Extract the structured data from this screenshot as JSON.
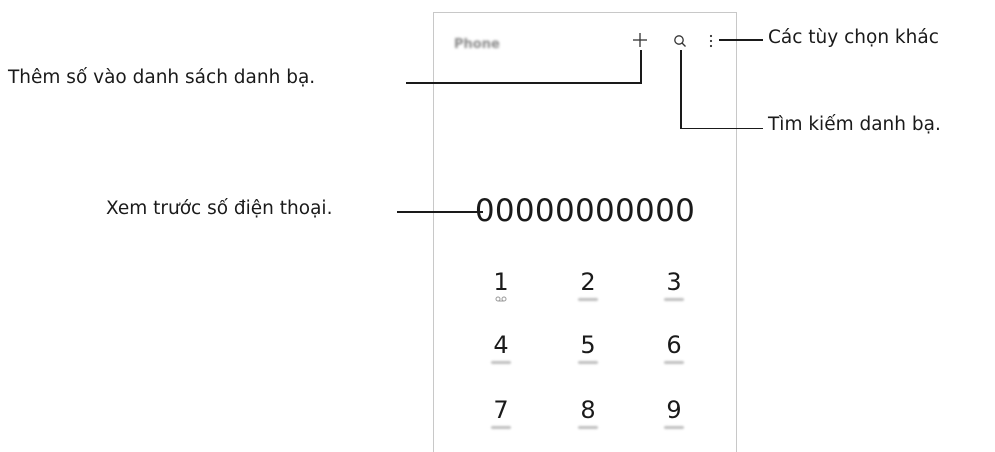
{
  "app": {
    "title": "Phone"
  },
  "number_preview": "00000000000",
  "keypad": [
    {
      "digit": "1",
      "sub": "voicemail-icon"
    },
    {
      "digit": "2",
      "sub": ""
    },
    {
      "digit": "3",
      "sub": ""
    },
    {
      "digit": "4",
      "sub": ""
    },
    {
      "digit": "5",
      "sub": ""
    },
    {
      "digit": "6",
      "sub": ""
    },
    {
      "digit": "7",
      "sub": ""
    },
    {
      "digit": "8",
      "sub": ""
    },
    {
      "digit": "9",
      "sub": ""
    }
  ],
  "callouts": {
    "more_options": "Các tùy chọn khác",
    "add_contact": "Thêm số vào danh sách danh bạ.",
    "search_contacts": "Tìm kiếm danh bạ.",
    "number_preview": "Xem trước số điện thoại."
  },
  "icons": {
    "add": "plus-icon",
    "search": "search-icon",
    "more": "more-vertical-icon"
  }
}
